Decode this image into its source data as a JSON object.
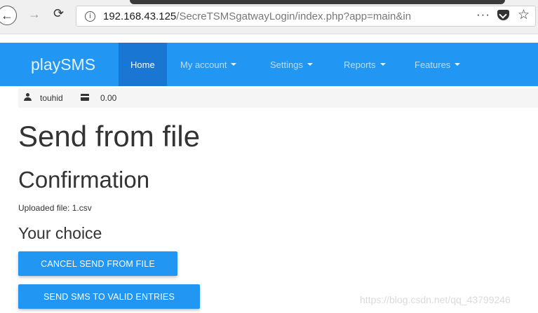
{
  "browser": {
    "url_host": "192.168.43.125",
    "url_path": "/SecreTSMSgatwayLogin/index.php?app=main&in",
    "back_icon": "arrow-left-icon",
    "forward_icon": "arrow-right-icon",
    "reload_icon": "reload-icon",
    "more_label": "···",
    "star_icon": "star-icon"
  },
  "navbar": {
    "brand": "playSMS",
    "items": [
      {
        "label": "Home",
        "active": true
      },
      {
        "label": "My account",
        "dropdown": true
      },
      {
        "label": "Settings",
        "dropdown": true
      },
      {
        "label": "Reports",
        "dropdown": true
      },
      {
        "label": "Features",
        "dropdown": true
      }
    ],
    "color": "#2196f3",
    "active_color": "#1976d2"
  },
  "user": {
    "name": "touhid",
    "credit": "0.00"
  },
  "content": {
    "title": "Send from file",
    "section": "Confirmation",
    "uploaded": "Uploaded file: 1.csv",
    "choice": "Your choice",
    "cancel_button": "CANCEL SEND FROM FILE",
    "send_button": "SEND SMS TO VALID ENTRIES"
  },
  "watermark": "https://blog.csdn.net/qq_43799246"
}
